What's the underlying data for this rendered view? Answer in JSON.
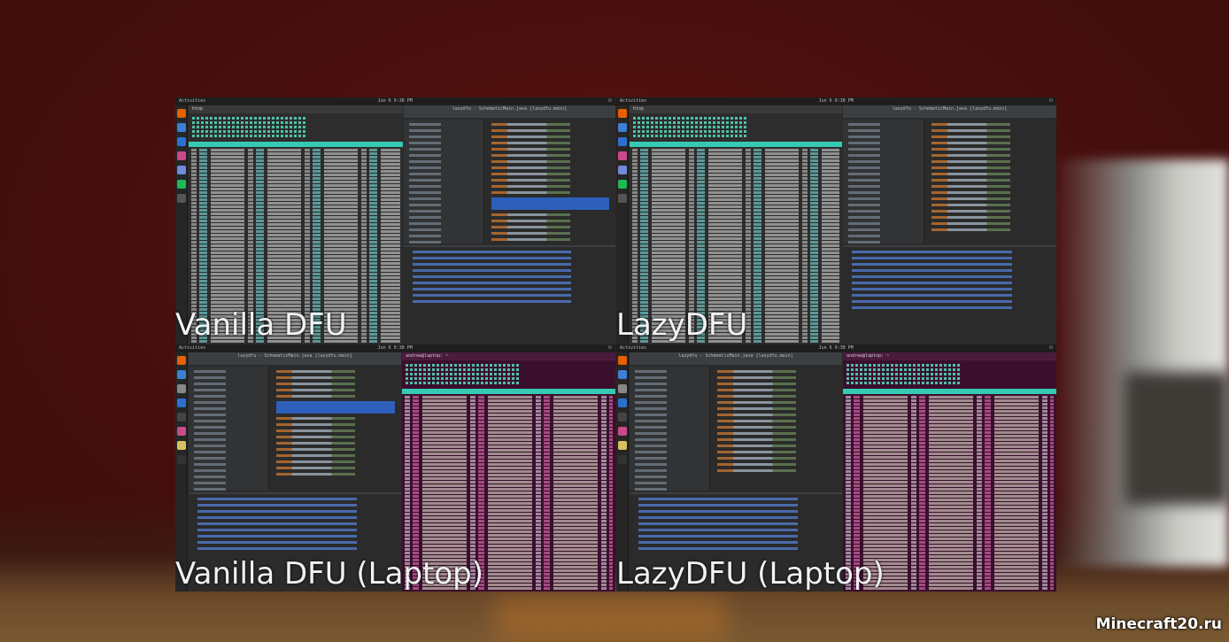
{
  "quadrants": [
    {
      "label": "Vanilla DFU",
      "topbar": {
        "activities": "Activities",
        "clock": "Jun 6 9:38 PM"
      },
      "ide_title": "lazydfu - SchematicMain.java [lazydfu.main]",
      "terminal_title": "htop"
    },
    {
      "label": "LazyDFU",
      "topbar": {
        "activities": "Activities",
        "clock": "Jun 6 9:38 PM"
      },
      "ide_title": "lazydfu - SchematicMain.java [lazydfu.main]",
      "terminal_title": "htop"
    },
    {
      "label": "Vanilla DFU (Laptop)",
      "topbar": {
        "activities": "Activities",
        "clock": "Jun 6 9:38 PM"
      },
      "ide_title": "lazydfu - SchematicMain.java [lazydfu.main]",
      "terminal_title": "andrew@laptop: ~"
    },
    {
      "label": "LazyDFU (Laptop)",
      "topbar": {
        "activities": "Activities",
        "clock": "Jun 6 9:38 PM"
      },
      "ide_title": "lazydfu - SchematicMain.java [lazydfu.main]",
      "terminal_title": "andrew@laptop: ~"
    }
  ],
  "watermark": "Minecraft20.ru",
  "colors": {
    "background": "#4a100f",
    "htop_header": "#36c9b3",
    "terminal_purple": "#3a0f2e",
    "ide_selection": "#2f65ca"
  }
}
